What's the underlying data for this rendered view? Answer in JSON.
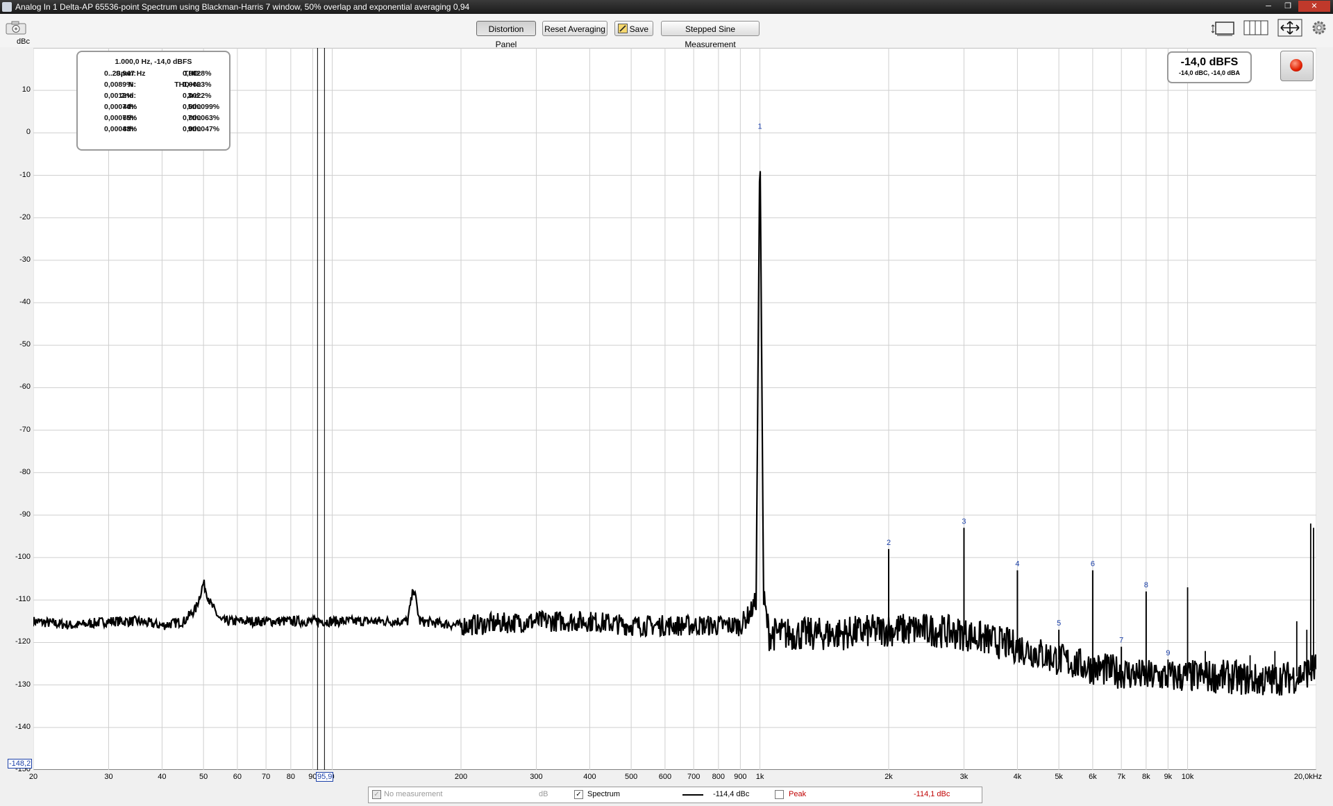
{
  "window": {
    "title": "Analog In 1 Delta-AP 65536-point Spectrum using Blackman-Harris 7 window, 50% overlap and exponential averaging 0,94"
  },
  "toolbar": {
    "distortion_panel": "Distortion Panel",
    "reset_averaging": "Reset Averaging",
    "save": "Save",
    "stepped_sine": "Stepped Sine Measurement",
    "unit": "dBc"
  },
  "info": {
    "header": "1.000,0 Hz, -14,0 dBFS",
    "rows": [
      {
        "l1": "Span:",
        "v1": "0..20.947 Hz",
        "l2": "THD:",
        "v2": "0,0028%"
      },
      {
        "l1": "N:",
        "v1": "0,0089%",
        "l2": "THD+N:",
        "v2": "0,0093%"
      },
      {
        "l1": "2nd:",
        "v1": "0,0012%",
        "l2": "3rd:",
        "v2": "0,0022%"
      },
      {
        "l1": "4th:",
        "v1": "0,00074%",
        "l2": "5th:",
        "v2": "0,000099%"
      },
      {
        "l1": "6th:",
        "v1": "0,00075%",
        "l2": "7th:",
        "v2": "0,000063%"
      },
      {
        "l1": "8th:",
        "v1": "0,00043%",
        "l2": "9th:",
        "v2": "0,000047%"
      }
    ]
  },
  "level": {
    "main": "-14,0 dBFS",
    "sub": "-14,0 dBC, -14,0 dBA"
  },
  "cursors": {
    "y_readout": "-148,2",
    "x_readout": "95,9"
  },
  "legend": {
    "no_measurement": "No measurement",
    "db": "dB",
    "spectrum": "Spectrum",
    "spectrum_value": "-114,4 dBc",
    "peak": "Peak",
    "peak_value": "-114,1 dBc"
  },
  "chart_data": {
    "type": "line",
    "xscale": "log",
    "xlim": [
      20,
      20000
    ],
    "ylim": [
      -150,
      20
    ],
    "ylabel": "dBc",
    "grid": true,
    "y_ticks": [
      "10",
      "0",
      "-10",
      "-20",
      "-30",
      "-40",
      "-50",
      "-60",
      "-70",
      "-80",
      "-90",
      "-100",
      "-110",
      "-120",
      "-130",
      "-140",
      "-150"
    ],
    "x_ticks": [
      {
        "v": 20,
        "t": "20"
      },
      {
        "v": 30,
        "t": "30"
      },
      {
        "v": 40,
        "t": "40"
      },
      {
        "v": 50,
        "t": "50"
      },
      {
        "v": 60,
        "t": "60"
      },
      {
        "v": 70,
        "t": "70"
      },
      {
        "v": 80,
        "t": "80"
      },
      {
        "v": 90,
        "t": "90"
      },
      {
        "v": 100,
        "t": "0"
      },
      {
        "v": 200,
        "t": "200"
      },
      {
        "v": 300,
        "t": "300"
      },
      {
        "v": 400,
        "t": "400"
      },
      {
        "v": 500,
        "t": "500"
      },
      {
        "v": 600,
        "t": "600"
      },
      {
        "v": 700,
        "t": "700"
      },
      {
        "v": 800,
        "t": "800"
      },
      {
        "v": 900,
        "t": "900"
      },
      {
        "v": 1000,
        "t": "1k"
      },
      {
        "v": 2000,
        "t": "2k"
      },
      {
        "v": 3000,
        "t": "3k"
      },
      {
        "v": 4000,
        "t": "4k"
      },
      {
        "v": 5000,
        "t": "5k"
      },
      {
        "v": 6000,
        "t": "6k"
      },
      {
        "v": 7000,
        "t": "7k"
      },
      {
        "v": 8000,
        "t": "8k"
      },
      {
        "v": 9000,
        "t": "9k"
      },
      {
        "v": 10000,
        "t": "10k"
      },
      {
        "v": 20000,
        "t": "20,0kHz"
      }
    ],
    "series": [
      {
        "name": "Spectrum",
        "x": [
          20,
          25,
          30,
          35,
          40,
          45,
          48,
          50,
          52,
          55,
          60,
          70,
          80,
          90,
          100,
          120,
          150,
          155,
          160,
          200,
          300,
          400,
          500,
          600,
          700,
          800,
          900,
          950,
          980,
          1000,
          1020,
          1050,
          1100,
          1500,
          2000,
          2500,
          3000,
          4000,
          5000,
          6000,
          7000,
          8000,
          9000,
          10000,
          12000,
          15000,
          18000,
          20000
        ],
        "y": [
          -115,
          -116,
          -115,
          -115,
          -116,
          -115,
          -112,
          -106,
          -111,
          -115,
          -115,
          -115,
          -115,
          -115,
          -115,
          -115,
          -115,
          -107,
          -115,
          -116,
          -115,
          -115,
          -116,
          -116,
          -116,
          -116,
          -116,
          -113,
          -110,
          0,
          -110,
          -118,
          -118,
          -118,
          -117,
          -117,
          -118,
          -121,
          -124,
          -126,
          -127,
          -128,
          -128,
          -128,
          -128,
          -129,
          -128,
          -126
        ]
      }
    ],
    "peaks": [
      {
        "label": "1",
        "freq": 1000,
        "db": 0
      },
      {
        "label": "2",
        "freq": 2000,
        "db": -98
      },
      {
        "label": "3",
        "freq": 3000,
        "db": -93
      },
      {
        "label": "4",
        "freq": 4000,
        "db": -103
      },
      {
        "label": "5",
        "freq": 5000,
        "db": -117
      },
      {
        "label": "6",
        "freq": 6000,
        "db": -103
      },
      {
        "label": "7",
        "freq": 7000,
        "db": -121
      },
      {
        "label": "8",
        "freq": 8000,
        "db": -108
      },
      {
        "label": "9",
        "freq": 9000,
        "db": -124
      }
    ],
    "spurs": [
      {
        "freq": 10000,
        "db": -107
      },
      {
        "freq": 11000,
        "db": -122
      },
      {
        "freq": 12000,
        "db": -126
      },
      {
        "freq": 13000,
        "db": -124
      },
      {
        "freq": 14000,
        "db": -123
      },
      {
        "freq": 15000,
        "db": -126
      },
      {
        "freq": 16000,
        "db": -122
      },
      {
        "freq": 17000,
        "db": -128
      },
      {
        "freq": 18000,
        "db": -115
      },
      {
        "freq": 19000,
        "db": -117
      },
      {
        "freq": 19400,
        "db": -92
      },
      {
        "freq": 20000,
        "db": -93
      }
    ],
    "cursor_x_hz": 95.9,
    "cursor_y_db": -148.2
  }
}
